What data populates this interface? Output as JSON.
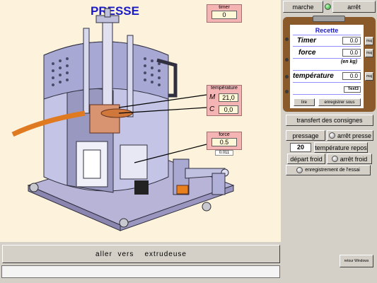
{
  "title": "PRESSE",
  "timer": {
    "label": "timer",
    "value": "0"
  },
  "temperature": {
    "label": "température",
    "m_label": "M",
    "c_label": "C",
    "m_value": "21,0",
    "c_value": "0,0"
  },
  "force": {
    "label": "force",
    "value": "0.5",
    "sub_value": "0.011"
  },
  "top_controls": {
    "start_label": "marche",
    "stop_label": "arrêt"
  },
  "recipe": {
    "title": "Recette",
    "timer_label": "Timer",
    "timer_value": "0.0",
    "force_label": "force",
    "force_value": "0.0",
    "force_unit": "(en kg)",
    "temp_label": "température",
    "temp_value": "0.0",
    "text_field": "Text3",
    "maj_label": "maj",
    "read_label": "lire",
    "save_as_label": "enregistrer sous"
  },
  "controls": {
    "transfer_label": "transfert des consignes",
    "press_label": "pressage",
    "stop_press_label": "arrêt presse",
    "rest_temp_value": "20",
    "rest_temp_label": "température repos",
    "cold_start_label": "départ froid",
    "cold_stop_label": "arrêt froid",
    "record_test_label": "enregistrement de l'essai"
  },
  "bottom": {
    "goto_label": "aller  vers    extrudeuse",
    "return_label": "retour Windows"
  },
  "colors": {
    "title": "#1a1ac8",
    "canvas": "#fdf3dc",
    "pink": "#f5b4b4",
    "led_on": "#1aa01a"
  }
}
